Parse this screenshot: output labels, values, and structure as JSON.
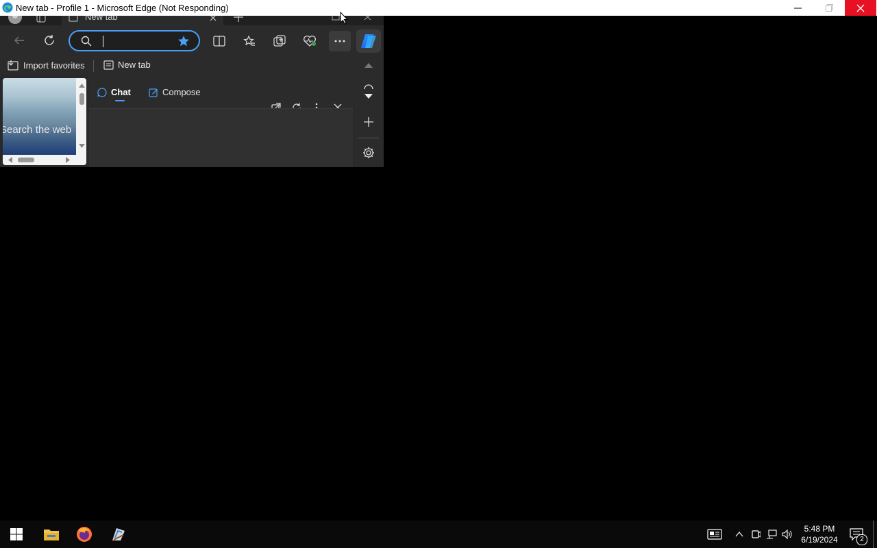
{
  "window": {
    "title": "New tab - Profile 1 - Microsoft Edge (Not Responding)"
  },
  "browser": {
    "active_tab_label": "New tab",
    "favorites_bar": {
      "import_favorites": "Import favorites",
      "new_tab": "New tab"
    },
    "preview": {
      "search_text": "Search the web"
    },
    "copilot_pane": {
      "tabs": [
        {
          "label": "Chat",
          "selected": true
        },
        {
          "label": "Compose",
          "selected": false
        }
      ]
    }
  },
  "taskbar": {
    "clock_time": "5:48 PM",
    "clock_date": "6/19/2024",
    "notification_count": "2"
  },
  "colors": {
    "accent": "#4a9df8",
    "close_button": "#e81123",
    "favorite_star": "#4a9df8"
  }
}
